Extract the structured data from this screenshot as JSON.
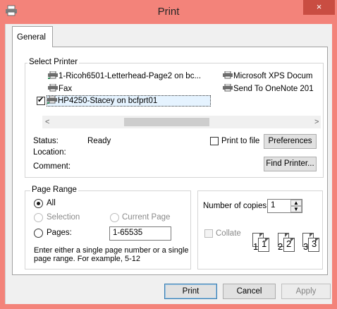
{
  "window": {
    "title": "Print",
    "close_glyph": "×",
    "accent_color": "#f3837a",
    "close_hover_color": "#c94d42"
  },
  "tabs": [
    {
      "label": "General"
    }
  ],
  "select_printer": {
    "label": "Select Printer",
    "printers": [
      {
        "name": "1-Ricoh6501-Letterhead-Page2 on bc...",
        "icon": "network-printer-icon",
        "selected": false
      },
      {
        "name": "Fax",
        "icon": "fax-icon",
        "selected": false
      },
      {
        "name": "HP4250-Stacey on bcfprt01",
        "icon": "network-printer-icon",
        "selected": true,
        "default": true
      },
      {
        "name": "Microsoft XPS Docum",
        "icon": "printer-icon",
        "selected": false
      },
      {
        "name": "Send To OneNote 201",
        "icon": "printer-icon",
        "selected": false
      }
    ],
    "scroll_left": "<",
    "scroll_right": ">",
    "status_label": "Status:",
    "status_value": "Ready",
    "location_label": "Location:",
    "location_value": "",
    "comment_label": "Comment:",
    "comment_value": "",
    "print_to_file_label": "Print to file",
    "print_to_file_checked": false,
    "preferences_label": "Preferences",
    "find_printer_label": "Find Printer..."
  },
  "page_range": {
    "label": "Page Range",
    "all_label": "All",
    "selection_label": "Selection",
    "current_page_label": "Current Page",
    "pages_label": "Pages:",
    "pages_value": "1-65535",
    "selected_option": "All",
    "help_text_line1": "Enter either a single page number or a single",
    "help_text_line2": "page range.  For example, 5-12"
  },
  "copies": {
    "number_label": "Number of copies:",
    "number_value": "1",
    "spin_up": "▲",
    "spin_down": "▼",
    "collate_label": "Collate",
    "collate_checked": false,
    "collate_pages": [
      "1",
      "1",
      "2",
      "2",
      "3",
      "3"
    ]
  },
  "buttons": {
    "print": "Print",
    "cancel": "Cancel",
    "apply": "Apply"
  }
}
